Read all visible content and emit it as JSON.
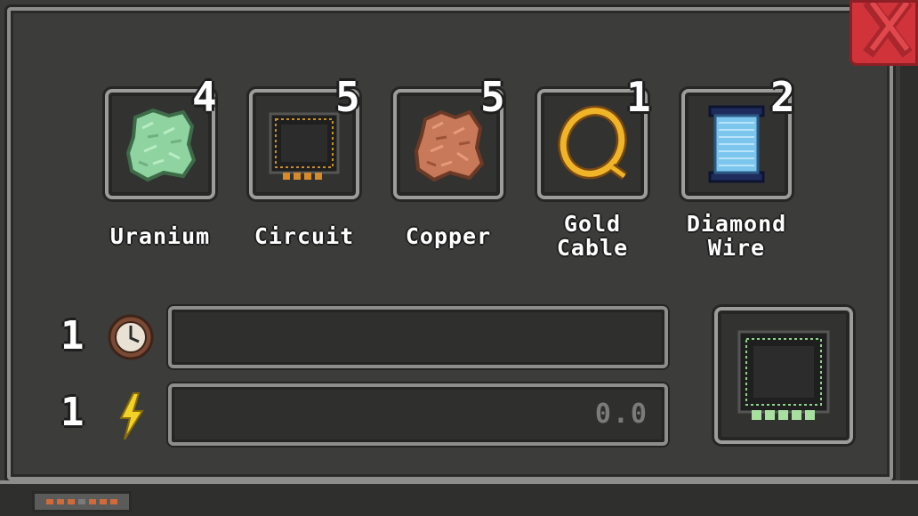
{
  "recipe": {
    "ingredients": [
      {
        "label": "Uranium",
        "count": "4",
        "icon": "uranium-ore-icon"
      },
      {
        "label": "Circuit",
        "count": "5",
        "icon": "circuit-chip-icon"
      },
      {
        "label": "Copper",
        "count": "5",
        "icon": "copper-ore-icon"
      },
      {
        "label": "Gold\nCable",
        "count": "1",
        "icon": "gold-cable-icon"
      },
      {
        "label": "Diamond\nWire",
        "count": "2",
        "icon": "diamond-wire-icon"
      }
    ]
  },
  "crafting": {
    "time_amount": "1",
    "time_icon": "clock-icon",
    "energy_amount": "1",
    "energy_icon": "lightning-icon",
    "progress_fraction": 0,
    "energy_value": "0.0"
  },
  "output": {
    "icon": "advanced-circuit-icon"
  },
  "colors": {
    "close_button": "#d0343a",
    "panel_border": "#8d8e8c",
    "panel_bg": "#3c3c3a"
  }
}
